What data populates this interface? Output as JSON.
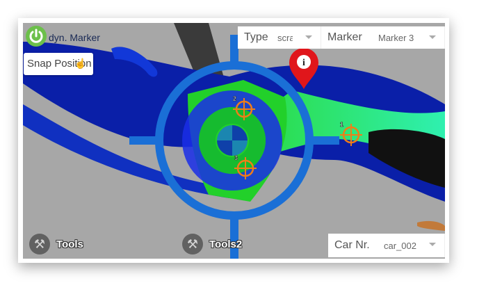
{
  "overlay": {
    "dyn_marker_label": "dyn. Marker",
    "snap_position_label": "Snap Position",
    "power_icon": "power-icon",
    "cursor_icon": "hand-pointer-icon"
  },
  "type_select": {
    "label": "Type",
    "value": "scra"
  },
  "marker_select": {
    "label": "Marker",
    "value": "Marker 3"
  },
  "car_select": {
    "label": "Car Nr.",
    "value": "car_002"
  },
  "tools": [
    {
      "label": "Tools",
      "icon": "tools-icon"
    },
    {
      "label": "Tools2",
      "icon": "tools-icon"
    }
  ],
  "markers": [
    {
      "number": "1"
    },
    {
      "number": "2"
    },
    {
      "number": "3"
    }
  ],
  "info_pin": {
    "icon": "info-pin-icon",
    "glyph": "i",
    "color": "#e0161b"
  },
  "colors": {
    "accent_blue": "#1a6fd6",
    "marker_orange": "#f07d18",
    "power_green": "#6cc04a"
  }
}
